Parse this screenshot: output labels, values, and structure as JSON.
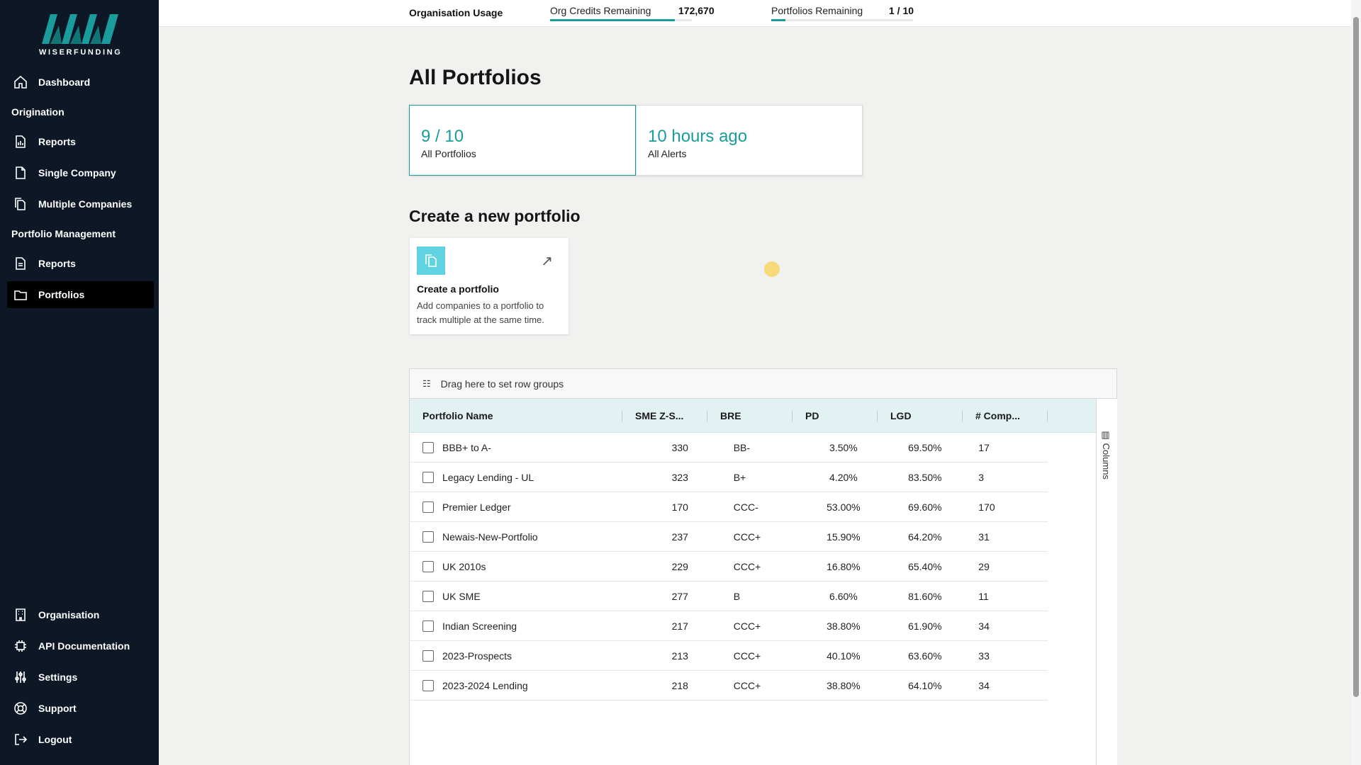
{
  "brand": {
    "logo_text": "WISERFUNDING",
    "accent": "#1a9c9c",
    "sidebar_bg": "#0e1726"
  },
  "sidebar": {
    "dashboard": "Dashboard",
    "section_origination": "Origination",
    "orig_reports": "Reports",
    "single_company": "Single Company",
    "multiple_companies": "Multiple Companies",
    "section_portfolio_mgmt": "Portfolio Management",
    "pm_reports": "Reports",
    "portfolios": "Portfolios",
    "organisation": "Organisation",
    "api_docs": "API Documentation",
    "settings": "Settings",
    "support": "Support",
    "logout": "Logout"
  },
  "topbar": {
    "title": "Organisation Usage",
    "credits_label": "Org Credits Remaining",
    "credits_value": "172,670",
    "credits_fill": 0.88,
    "portfolios_label": "Portfolios Remaining",
    "portfolios_value": "1 / 10",
    "portfolios_fill": 0.1
  },
  "main": {
    "title": "All Portfolios",
    "stats": [
      {
        "value": "9 / 10",
        "label": "All Portfolios"
      },
      {
        "value": "10 hours ago",
        "label": "All Alerts"
      }
    ],
    "create_section_title": "Create a new portfolio",
    "create_card": {
      "title": "Create a portfolio",
      "description": "Add companies to a portfolio to track multiple at the same time."
    }
  },
  "grid": {
    "group_bar_text": "Drag here to set row groups",
    "columns_button": "Columns",
    "headers": [
      "Portfolio Name",
      "SME Z-S...",
      "BRE",
      "PD",
      "LGD",
      "# Comp..."
    ],
    "rows": [
      [
        "BBB+ to A-",
        "330",
        "BB-",
        "3.50%",
        "69.50%",
        "17"
      ],
      [
        "Legacy Lending - UL",
        "323",
        "B+",
        "4.20%",
        "83.50%",
        "3"
      ],
      [
        "Premier Ledger",
        "170",
        "CCC-",
        "53.00%",
        "69.60%",
        "170"
      ],
      [
        "Newais-New-Portfolio",
        "237",
        "CCC+",
        "15.90%",
        "64.20%",
        "31"
      ],
      [
        "UK 2010s",
        "229",
        "CCC+",
        "16.80%",
        "65.40%",
        "29"
      ],
      [
        "UK SME",
        "277",
        "B",
        "6.60%",
        "81.60%",
        "11"
      ],
      [
        "Indian Screening",
        "217",
        "CCC+",
        "38.80%",
        "61.90%",
        "34"
      ],
      [
        "2023-Prospects",
        "213",
        "CCC+",
        "40.10%",
        "63.60%",
        "33"
      ],
      [
        "2023-2024 Lending",
        "218",
        "CCC+",
        "38.80%",
        "64.10%",
        "34"
      ]
    ]
  }
}
